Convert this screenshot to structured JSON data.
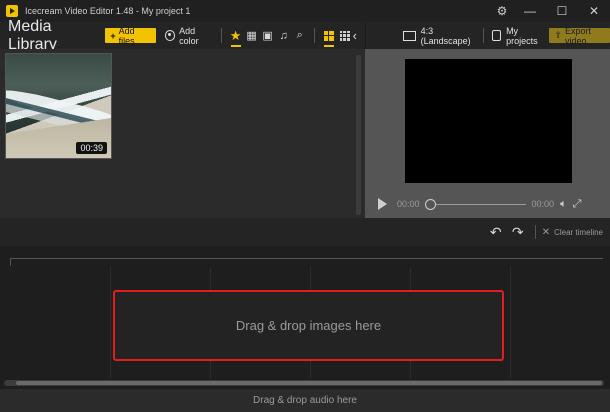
{
  "window": {
    "title": "Icecream Video Editor 1.48  -  My project 1",
    "settings_icon": "gear-icon",
    "min_icon": "minimize-icon",
    "max_icon": "maximize-icon",
    "close_icon": "close-icon"
  },
  "media": {
    "title": "Media Library",
    "add_files": "Add files",
    "add_color": "Add color",
    "thumbnail": {
      "duration": "00:39"
    }
  },
  "preview": {
    "aspect": "4:3 (Landscape)",
    "my_projects": "My projects",
    "export": "Export video",
    "time_current": "00:00",
    "time_total": "00:00",
    "seek_progress": 0
  },
  "timeline": {
    "clear": "Clear timeline",
    "drop_images": "Drag & drop images here",
    "drop_audio": "Drag & drop audio here"
  },
  "colors": {
    "accent": "#f2c300",
    "dropzone_border": "#e21d1d"
  }
}
